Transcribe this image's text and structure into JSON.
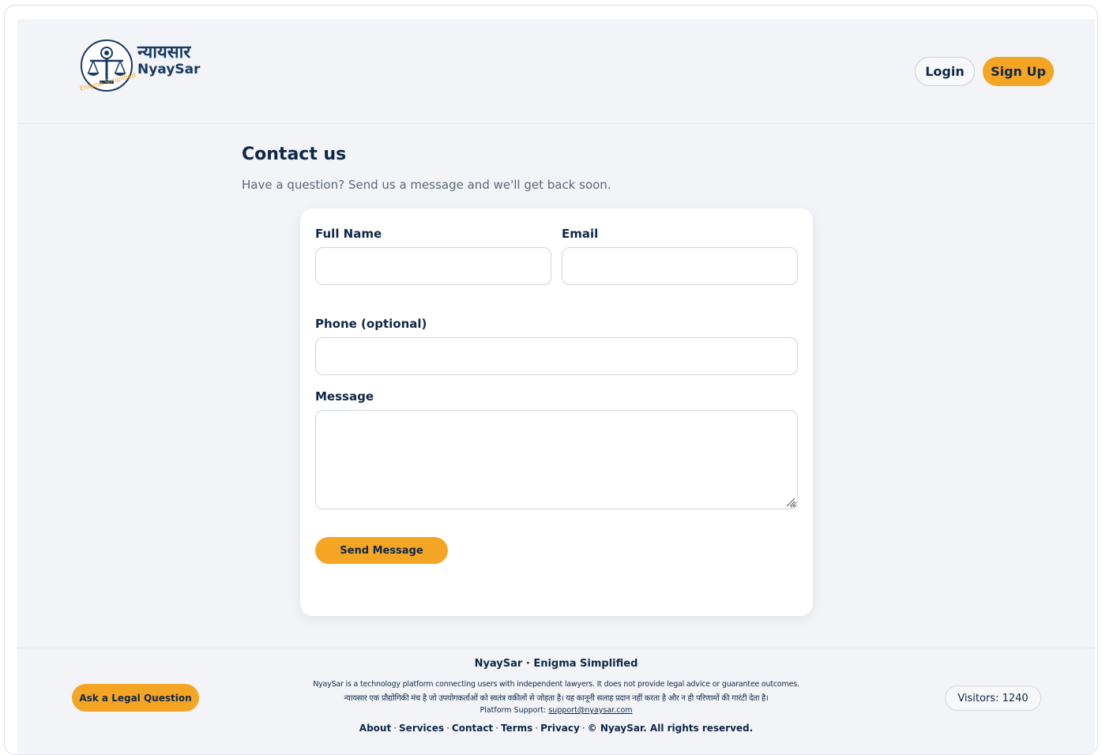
{
  "brand": {
    "name_hindi": "न्यायसार",
    "name": "NyaySar",
    "tagline": "Enigma Simplified"
  },
  "header": {
    "login_label": "Login",
    "signup_label": "Sign Up"
  },
  "page": {
    "title": "Contact us",
    "subtitle": "Have a question? Send us a message and we'll get back soon."
  },
  "form": {
    "full_name_label": "Full Name",
    "full_name_value": "",
    "email_label": "Email",
    "email_value": "",
    "phone_label": "Phone (optional)",
    "phone_value": "",
    "message_label": "Message",
    "message_value": "",
    "submit_label": "Send Message"
  },
  "footer": {
    "brand_line": "NyaySar · Enigma Simplified",
    "disclaimer_en": "NyaySar is a technology platform connecting users with independent lawyers. It does not provide legal advice or guarantee outcomes.",
    "disclaimer_hi": "न्यायसार एक प्रौद्योगिकी मंच है जो उपयोगकर्ताओं को स्वतंत्र वकीलों से जोड़ता है। यह कानूनी सलाह प्रदान नहीं करता है और न ही परिणामों की गारंटी देता है।",
    "support_prefix": "Platform Support:",
    "support_email": "support@nyaysar.com",
    "links": [
      "About",
      "Services",
      "Contact",
      "Terms",
      "Privacy"
    ],
    "copyright": "© NyaySar. All rights reserved.",
    "ask_label": "Ask a Legal Question",
    "visitors_label": "Visitors: 1240"
  },
  "colors": {
    "accent": "#f5a524",
    "navy": "#0f2747",
    "background": "#f2f4f7"
  }
}
